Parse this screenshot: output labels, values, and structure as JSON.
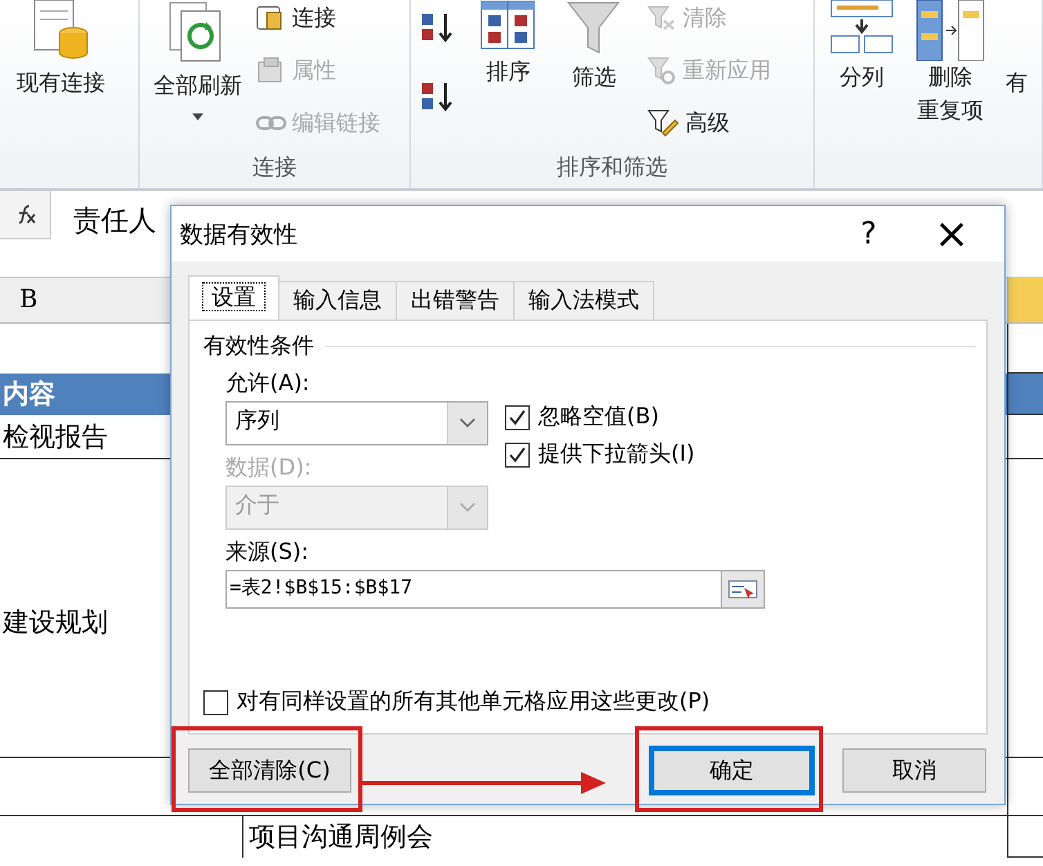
{
  "ribbon": {
    "groups": [
      {
        "items": [
          {
            "kind": "large",
            "label": "现有连接"
          }
        ]
      },
      {
        "label": "连接",
        "items": [
          {
            "kind": "large",
            "label": "全部刷新",
            "dropdown": true
          },
          {
            "kind": "small",
            "label": "连接",
            "disabled": false
          },
          {
            "kind": "small",
            "label": "属性",
            "disabled": true
          },
          {
            "kind": "small",
            "label": "编辑链接",
            "disabled": true
          }
        ]
      },
      {
        "label": "排序和筛选",
        "items": [
          {
            "kind": "iconcol"
          },
          {
            "kind": "large",
            "label": "排序"
          },
          {
            "kind": "large",
            "label": "筛选"
          },
          {
            "kind": "small",
            "label": "清除",
            "disabled": true
          },
          {
            "kind": "small",
            "label": "重新应用",
            "disabled": true
          },
          {
            "kind": "small",
            "label": "高级",
            "disabled": false
          }
        ]
      },
      {
        "items": [
          {
            "kind": "large",
            "label": "分列"
          },
          {
            "kind": "large",
            "label_lines": [
              "删除",
              "重复项"
            ]
          },
          {
            "kind": "large",
            "label": "有"
          }
        ]
      }
    ]
  },
  "formula_bar": {
    "value": "责任人"
  },
  "sheet": {
    "column_header": "B",
    "rows": [
      {
        "kind": "blank"
      },
      {
        "kind": "header",
        "text": "内容"
      },
      {
        "kind": "cell",
        "text": "检视报告"
      },
      {
        "kind": "tall",
        "text": "建设规划"
      },
      {
        "kind": "gap"
      },
      {
        "kind": "indented",
        "text": "项目沟通周例会"
      }
    ]
  },
  "dialog": {
    "title": "数据有效性",
    "help": "?",
    "close": "×",
    "tabs": [
      {
        "label": "设置",
        "selected": true
      },
      {
        "label": "输入信息",
        "selected": false
      },
      {
        "label": "出错警告",
        "selected": false
      },
      {
        "label": "输入法模式",
        "selected": false
      }
    ],
    "section_title": "有效性条件",
    "allow": {
      "label": "允许(A):",
      "value": "序列",
      "disabled": false
    },
    "data": {
      "label": "数据(D):",
      "value": "介于",
      "disabled": true
    },
    "source": {
      "label": "来源(S):",
      "value": "=表2!$B$15:$B$17"
    },
    "checkboxes": [
      {
        "label": "忽略空值(B)",
        "checked": true
      },
      {
        "label": "提供下拉箭头(I)",
        "checked": true
      }
    ],
    "apply_all": {
      "label": "对有同样设置的所有其他单元格应用这些更改(P)",
      "checked": false
    },
    "buttons": [
      {
        "label": "全部清除(C)",
        "kind": "clear",
        "highlighted": true
      },
      {
        "label": "确定",
        "kind": "ok",
        "highlighted": true
      },
      {
        "label": "取消",
        "kind": "cancel",
        "highlighted": false
      }
    ]
  }
}
